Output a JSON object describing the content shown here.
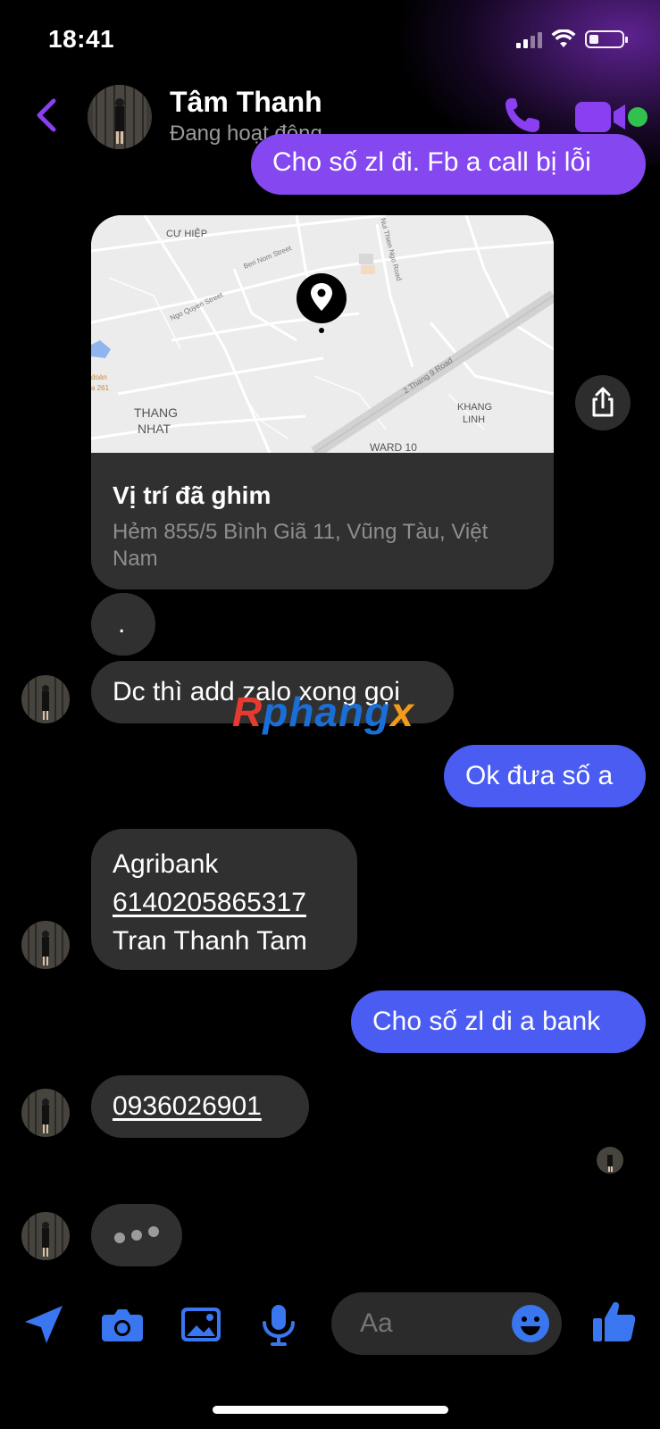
{
  "status_bar": {
    "time": "18:41",
    "battery_level": 0.3
  },
  "header": {
    "contact_name": "Tâm Thanh",
    "contact_status": "Đang hoạt động",
    "accent_color": "#8a3ff0",
    "online": true
  },
  "messages": {
    "top_outgoing": "Cho số zl đi. Fb a call bị lỗi",
    "map": {
      "title": "Vị trí đã ghim",
      "address": "Hẻm 855/5 Bình Giã 11, Vũng Tàu, Việt Nam",
      "labels": {
        "cu_hiep": "CƯ HIỆP",
        "beri_nom": "Beri Nom Street",
        "ngo_quyen": "Ngo Quyen Street",
        "ngo_road": "Nui Thien Ngo Road",
        "thang_nhat_1": "THANG",
        "thang_nhat_2": "NHAT",
        "khang_linh_1": "KHANG",
        "khang_linh_2": "LINH",
        "road_2_thang_9": "2 Thang 9 Road",
        "ward10": "WARD 10",
        "doan": "doàn",
        "num261": "a 261"
      }
    },
    "dot_message": ".",
    "msg_dc": "Dc thì add zalo xong gọi",
    "msg_ok": "Ok đưa số a",
    "bank": {
      "line1": "Agribank",
      "account": "6140205865317",
      "name": "Tran Thanh Tam"
    },
    "msg_cho": "Cho số zl di a bank",
    "phone": "0936026901"
  },
  "watermark": {
    "part1": "R",
    "part2": "phang",
    "part3": "x"
  },
  "composer": {
    "placeholder": "Aa"
  },
  "colors": {
    "incoming_bubble": "#303030",
    "outgoing_bubble": "#4b5cf3",
    "accent_bubble": "#8447f0",
    "toolbar_icon": "#3a76f0"
  }
}
